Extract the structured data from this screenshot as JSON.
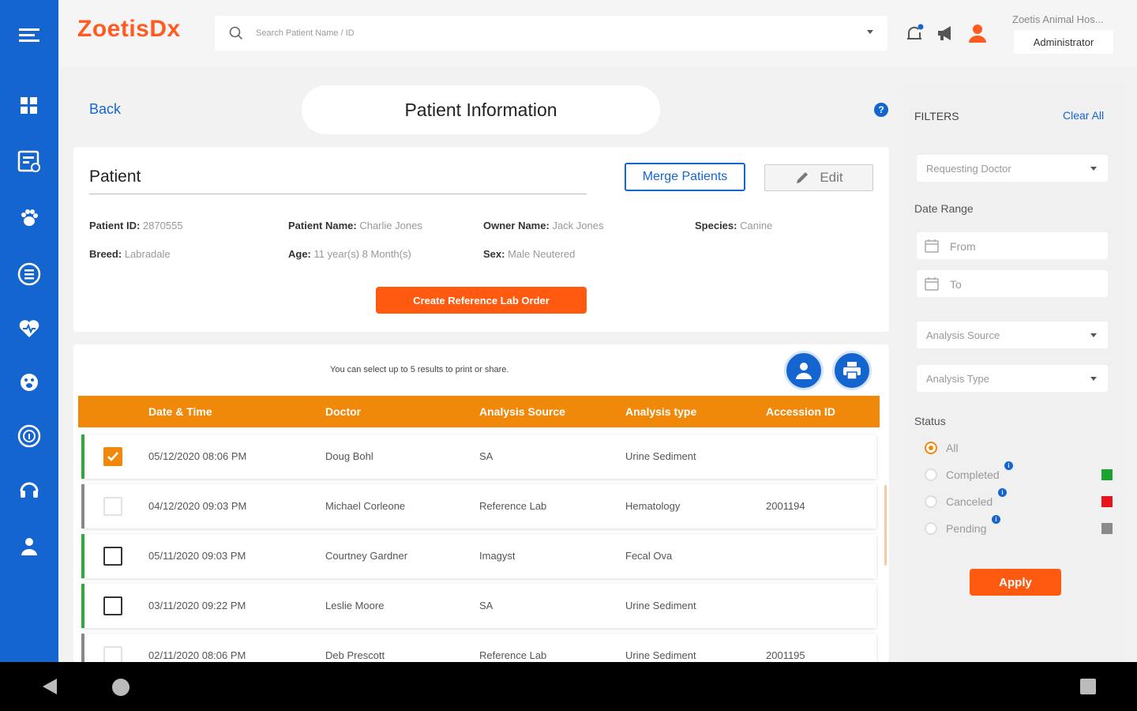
{
  "app": {
    "logo": "ZoetisDx"
  },
  "header": {
    "search_placeholder": "Search Patient Name / ID",
    "hospital": "Zoetis Animal Hos...",
    "role": "Administrator"
  },
  "page": {
    "back_label": "Back",
    "title": "Patient Information",
    "help_symbol": "?"
  },
  "patient": {
    "section_title": "Patient",
    "merge_label": "Merge Patients",
    "edit_label": "Edit",
    "fields": {
      "patient_id": {
        "label": "Patient ID:",
        "value": "2870555"
      },
      "patient_name": {
        "label": "Patient Name:",
        "value": "Charlie Jones"
      },
      "owner_name": {
        "label": "Owner Name:",
        "value": "Jack Jones"
      },
      "species": {
        "label": "Species:",
        "value": "Canine"
      },
      "breed": {
        "label": "Breed:",
        "value": "Labradale"
      },
      "age": {
        "label": "Age:",
        "value": "11 year(s) 8 Month(s)"
      },
      "sex": {
        "label": "Sex:",
        "value": "Male Neutered"
      }
    },
    "create_order_label": "Create Reference Lab Order"
  },
  "results": {
    "note": "You can select up to 5 results to print or share.",
    "columns": [
      "Date & Time",
      "Doctor",
      "Analysis Source",
      "Analysis type",
      "Accession ID"
    ],
    "rows": [
      {
        "checked": true,
        "enabled": true,
        "status_color": "#2eaa3a",
        "datetime": "05/12/2020 08:06 PM",
        "doctor": "Doug Bohl",
        "source": "SA",
        "type": "Urine Sediment",
        "accession": ""
      },
      {
        "checked": false,
        "enabled": false,
        "status_color": "#888888",
        "datetime": "04/12/2020 09:03 PM",
        "doctor": "Michael Corleone",
        "source": "Reference Lab",
        "type": "Hematology",
        "accession": "2001194"
      },
      {
        "checked": false,
        "enabled": true,
        "status_color": "#2eaa3a",
        "datetime": "05/11/2020 09:03 PM",
        "doctor": "Courtney Gardner",
        "source": "Imagyst",
        "type": "Fecal Ova",
        "accession": ""
      },
      {
        "checked": false,
        "enabled": true,
        "status_color": "#2eaa3a",
        "datetime": "03/11/2020 09:22 PM",
        "doctor": "Leslie Moore",
        "source": "SA",
        "type": "Urine Sediment",
        "accession": ""
      },
      {
        "checked": false,
        "enabled": false,
        "status_color": "#888888",
        "datetime": "02/11/2020 08:06 PM",
        "doctor": "Deb Prescott",
        "source": "Reference Lab",
        "type": "Urine Sediment",
        "accession": "2001195"
      }
    ]
  },
  "filters": {
    "title": "FILTERS",
    "clear_all": "Clear All",
    "requesting_doctor": "Requesting Doctor",
    "date_range": "Date Range",
    "from": "From",
    "to": "To",
    "analysis_source": "Analysis Source",
    "analysis_type": "Analysis Type",
    "status_label": "Status",
    "statuses": [
      {
        "label": "All",
        "selected": true,
        "info": false,
        "color": ""
      },
      {
        "label": "Completed",
        "selected": false,
        "info": true,
        "color": "#1aa331"
      },
      {
        "label": "Canceled",
        "selected": false,
        "info": true,
        "color": "#e8141c"
      },
      {
        "label": "Pending",
        "selected": false,
        "info": true,
        "color": "#8a8a8a"
      }
    ],
    "apply_label": "Apply"
  },
  "colors": {
    "brand_blue": "#1565d0",
    "accent_orange": "#f0880a",
    "logo_orange": "#ff5a1f"
  }
}
